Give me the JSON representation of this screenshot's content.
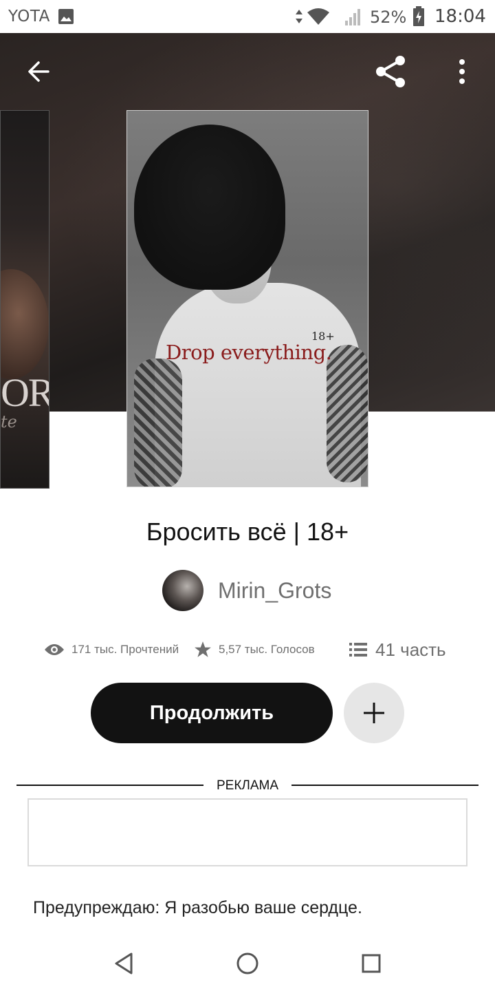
{
  "status_bar": {
    "carrier": "YOTA",
    "battery": "52%",
    "time": "18:04"
  },
  "side_cover": {
    "title_fragment": "ORE",
    "subtitle_fragment": "te"
  },
  "cover": {
    "title": "Drop everything.",
    "age": "18+"
  },
  "book": {
    "title": "Бросить всё | 18+",
    "author": "Mirin_Grots",
    "stats": {
      "reads": "171 тыс. Прочтений",
      "votes": "5,57 тыс. Голосов",
      "parts": "41 часть"
    },
    "continue_label": "Продолжить",
    "description": "Предупреждаю: Я разобью ваше сердце."
  },
  "ad": {
    "label": "РЕКЛАМА"
  },
  "icons": {
    "back": "arrow-left-icon",
    "share": "share-icon",
    "menu": "more-vertical-icon",
    "reads": "eye-icon",
    "votes": "star-icon",
    "parts": "list-icon",
    "add": "plus-icon"
  },
  "colors": {
    "primary": "#121212",
    "muted_text": "#6f6f6f",
    "add_button_bg": "#e6e6e6",
    "cover_title": "#8a1c1c"
  }
}
